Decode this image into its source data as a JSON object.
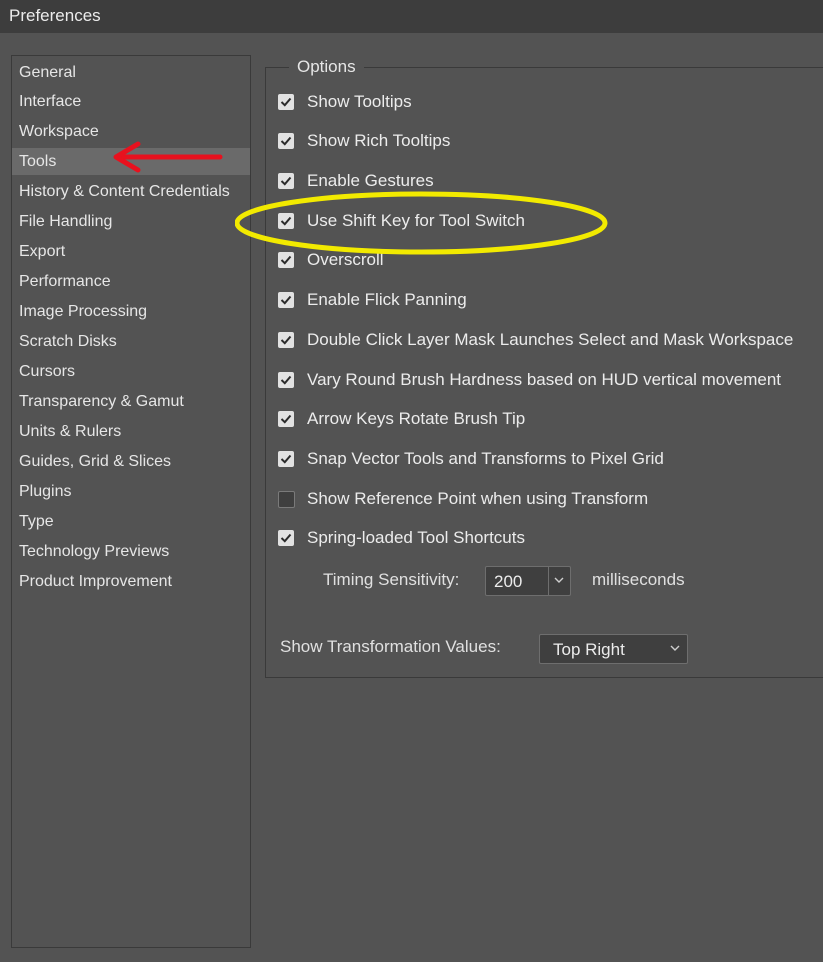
{
  "window": {
    "title": "Preferences"
  },
  "sidebar": {
    "items": [
      {
        "label": "General"
      },
      {
        "label": "Interface"
      },
      {
        "label": "Workspace"
      },
      {
        "label": "Tools",
        "selected": true
      },
      {
        "label": "History & Content Credentials"
      },
      {
        "label": "File Handling"
      },
      {
        "label": "Export"
      },
      {
        "label": "Performance"
      },
      {
        "label": "Image Processing"
      },
      {
        "label": "Scratch Disks"
      },
      {
        "label": "Cursors"
      },
      {
        "label": "Transparency & Gamut"
      },
      {
        "label": "Units & Rulers"
      },
      {
        "label": "Guides, Grid & Slices"
      },
      {
        "label": "Plugins"
      },
      {
        "label": "Type"
      },
      {
        "label": "Technology Previews"
      },
      {
        "label": "Product Improvement"
      }
    ]
  },
  "options": {
    "legend": "Options",
    "checkboxes": [
      {
        "label": "Show Tooltips",
        "checked": true
      },
      {
        "label": "Show Rich Tooltips",
        "checked": true
      },
      {
        "label": "Enable Gestures",
        "checked": true
      },
      {
        "label": "Use Shift Key for Tool Switch",
        "checked": true
      },
      {
        "label": "Overscroll",
        "checked": true
      },
      {
        "label": "Enable Flick Panning",
        "checked": true
      },
      {
        "label": "Double Click Layer Mask Launches Select and Mask Workspace",
        "checked": true
      },
      {
        "label": "Vary Round Brush Hardness based on HUD vertical movement",
        "checked": true
      },
      {
        "label": "Arrow Keys Rotate Brush Tip",
        "checked": true
      },
      {
        "label": "Snap Vector Tools and Transforms to Pixel Grid",
        "checked": true
      },
      {
        "label": "Show Reference Point when using Transform",
        "checked": false
      },
      {
        "label": "Spring-loaded Tool Shortcuts",
        "checked": true
      }
    ],
    "timing": {
      "label": "Timing Sensitivity:",
      "value": "200",
      "unit": "milliseconds"
    },
    "transform_values": {
      "label": "Show Transformation Values:",
      "value": "Top Right"
    }
  },
  "colors": {
    "background": "#535353",
    "titlebar": "#3d3d3d",
    "selected_item": "#6a6a6a",
    "annotation_arrow": "#e8111e",
    "annotation_ellipse": "#f2ea00"
  }
}
